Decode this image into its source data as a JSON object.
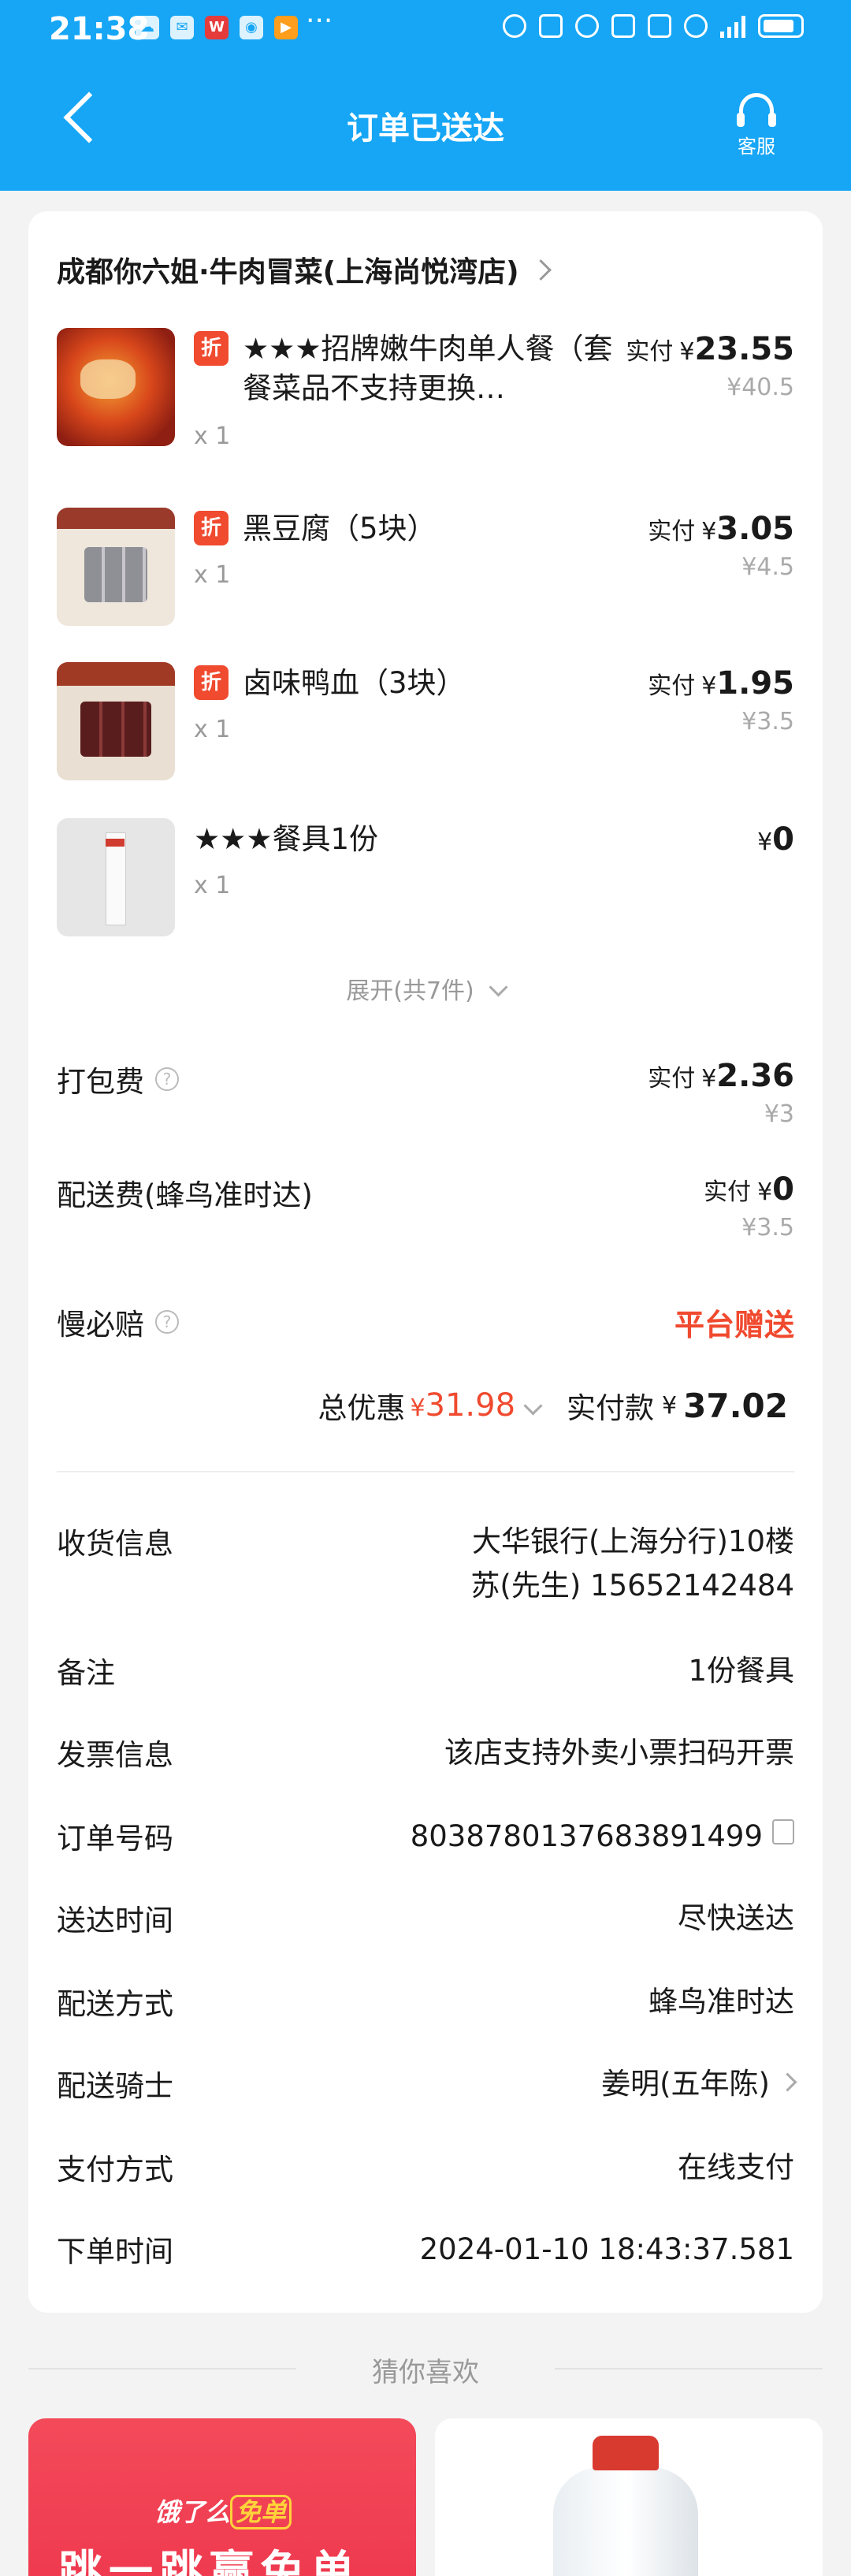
{
  "status_bar": {
    "time": "21:38",
    "app_icons": [
      "cloud-icon",
      "wechat-icon",
      "wps-icon",
      "location-app-icon",
      "video-app-icon"
    ],
    "more": "···",
    "network": "4G"
  },
  "header": {
    "title": "订单已送达",
    "service_label": "客服",
    "colors": {
      "background": "#16a6f5"
    }
  },
  "store": {
    "name": "成都你六姐·牛肉冒菜(上海尚悦湾店)"
  },
  "items": [
    {
      "name": "★★★招牌嫩牛肉单人餐（套餐菜品不支持更换…",
      "qty": "x 1",
      "paid_label": "实付",
      "currency": "¥",
      "price": "23.55",
      "original": "¥40.5",
      "badge": "折"
    },
    {
      "name": "黑豆腐（5块）",
      "qty": "x 1",
      "paid_label": "实付",
      "currency": "¥",
      "price": "3.05",
      "original": "¥4.5",
      "badge": "折"
    },
    {
      "name": "卤味鸭血（3块）",
      "qty": "x 1",
      "paid_label": "实付",
      "currency": "¥",
      "price": "1.95",
      "original": "¥3.5",
      "badge": "折"
    },
    {
      "name": "★★★餐具1份",
      "qty": "x 1",
      "currency": "¥",
      "price": "0"
    }
  ],
  "expand_label": "展开(共7件)",
  "fees": {
    "packing": {
      "label": "打包费",
      "paid_label": "实付",
      "currency": "¥",
      "price": "2.36",
      "original": "¥3"
    },
    "delivery": {
      "label": "配送费(蜂鸟准时达)",
      "paid_label": "实付",
      "currency": "¥",
      "price": "0",
      "original": "¥3.5"
    },
    "late_comp": {
      "label": "慢必赔",
      "value": "平台赠送"
    }
  },
  "summary": {
    "discount_label": "总优惠",
    "discount_currency": "¥",
    "discount_value": "31.98",
    "paid_label": "实付款",
    "paid_currency": "¥",
    "paid_value": "37.02"
  },
  "info": [
    {
      "label": "收货信息",
      "lines": [
        "大华银行(上海分行)10楼",
        "苏(先生) 15652142484"
      ]
    },
    {
      "label": "备注",
      "value": "1份餐具"
    },
    {
      "label": "发票信息",
      "value": "该店支持外卖小票扫码开票"
    },
    {
      "label": "订单号码",
      "value": "8038780137683891499"
    },
    {
      "label": "送达时间",
      "value": "尽快送达"
    },
    {
      "label": "配送方式",
      "value": "蜂鸟准时达"
    },
    {
      "label": "配送骑士",
      "value": "姜明(五年陈)"
    },
    {
      "label": "支付方式",
      "value": "在线支付"
    },
    {
      "label": "下单时间",
      "value": "2024-01-10 18:43:37.581"
    }
  ],
  "recommend": {
    "title": "猜你喜欢",
    "banner_logo_a": "饿了么",
    "banner_logo_b": "免单",
    "banner_text": "跳一跳赢免单"
  },
  "colors": {
    "accent_red": "#f04a2f",
    "page_bg": "#f3f3f3"
  }
}
